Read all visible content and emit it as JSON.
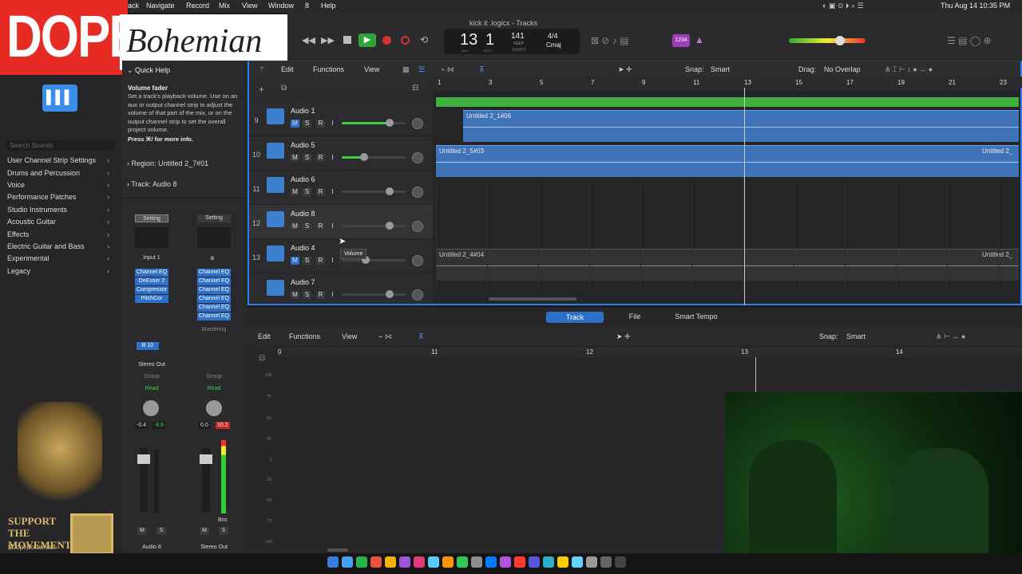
{
  "menubar": {
    "items": [
      "ack",
      "Navigate",
      "Record",
      "Mix",
      "View",
      "Window",
      "8",
      "Help"
    ],
    "clock": "Thu Aug 14  10:35 PM"
  },
  "branding": {
    "dope": "DOPE",
    "bohemian": "Bohemian",
    "support": "SUPPORT THE MOVEMENT",
    "handle": "$DopeBohemian"
  },
  "window": {
    "title": "kick it .logicx - Tracks"
  },
  "transport": {
    "bar": "13",
    "beat": "1",
    "bar_label": "BAR",
    "beat_label": "BEAT",
    "tempo": "141",
    "tempo_sub": "KEEP",
    "tempo_label": "TEMPO",
    "time_sig": "4/4",
    "key": "Cmaj",
    "count_in": "1234"
  },
  "tracks_toolbar": {
    "edit": "Edit",
    "functions": "Functions",
    "view": "View",
    "snap_label": "Snap:",
    "snap_value": "Smart",
    "drag_label": "Drag:",
    "drag_value": "No Overlap"
  },
  "quick_help": {
    "title": "Quick Help",
    "heading": "Volume fader",
    "body": "Set a track's playback volume. Use on an aux or output channel strip to adjust the volume of that part of the mix, or on the output channel strip to set the overall project volume.",
    "more": "Press ⌘/ for more info."
  },
  "inspector": {
    "region_label": "Region:",
    "region_value": "Untitled 2_7#01",
    "track_label": "Track:",
    "track_value": "Audio 8",
    "strip1": {
      "setting": "Setting",
      "input": "Input 1",
      "plugins": [
        "Channel EQ",
        "DeEsser 2",
        "Compressor",
        "PitchCor"
      ],
      "send": "B 10",
      "output": "Stereo Out",
      "group": "Group",
      "automation": "Read",
      "vol": "-0.4",
      "peak": "-8.8",
      "name": "Audio 8",
      "m": "M",
      "s": "S"
    },
    "strip2": {
      "setting": "Setting",
      "plugins": [
        "Channel EQ",
        "Channel EQ",
        "Channel EQ",
        "Channel EQ",
        "Channel EQ",
        "Channel EQ"
      ],
      "mastering": "Mastering",
      "group": "Group",
      "automation": "Read",
      "vol": "0.0",
      "peak": "10.2",
      "bnc": "Bnc",
      "name": "Stereo Out",
      "m": "M",
      "s": "S"
    }
  },
  "library": {
    "search_placeholder": "Search Sounds",
    "items": [
      "User Channel Strip Settings",
      "Drums and Percussion",
      "Voice",
      "Performance Patches",
      "Studio Instruments",
      "Acoustic Guitar",
      "Effects",
      "Electric Guitar and Bass",
      "Experimental",
      "Legacy"
    ]
  },
  "tracks": [
    {
      "num": "9",
      "name": "Audio 1",
      "level": 0.75
    },
    {
      "num": "10",
      "name": "Audio 5",
      "level": 0.35
    },
    {
      "num": "11",
      "name": "Audio 6",
      "level": 0
    },
    {
      "num": "12",
      "name": "Audio 8",
      "level": 0
    },
    {
      "num": "13",
      "name": "Audio 4",
      "level": 0
    },
    {
      "num": "",
      "name": "Audio 7",
      "level": 0
    }
  ],
  "buttons": {
    "m": "M",
    "s": "S",
    "r": "R",
    "i": "I"
  },
  "tooltip": "Volume",
  "ruler": [
    "1",
    "3",
    "5",
    "7",
    "9",
    "11",
    "13",
    "15",
    "17",
    "19",
    "21",
    "23"
  ],
  "regions": [
    {
      "name": "Untitled 2_1#06"
    },
    {
      "name": "Untitled 2_5#03"
    },
    {
      "name": "Untitled 2_"
    },
    {
      "name": "Untitled 2_4#04"
    },
    {
      "name": "Untitled 2_"
    }
  ],
  "editor": {
    "tabs": [
      "Track",
      "File",
      "Smart Tempo"
    ],
    "edit": "Edit",
    "functions": "Functions",
    "view": "View",
    "snap_label": "Snap:",
    "snap_value": "Smart",
    "ruler": [
      "0",
      "11",
      "12",
      "13",
      "14"
    ],
    "scale": [
      "100",
      "75",
      "50",
      "25",
      "0",
      "-25",
      "-50",
      "-75",
      "-100"
    ]
  }
}
